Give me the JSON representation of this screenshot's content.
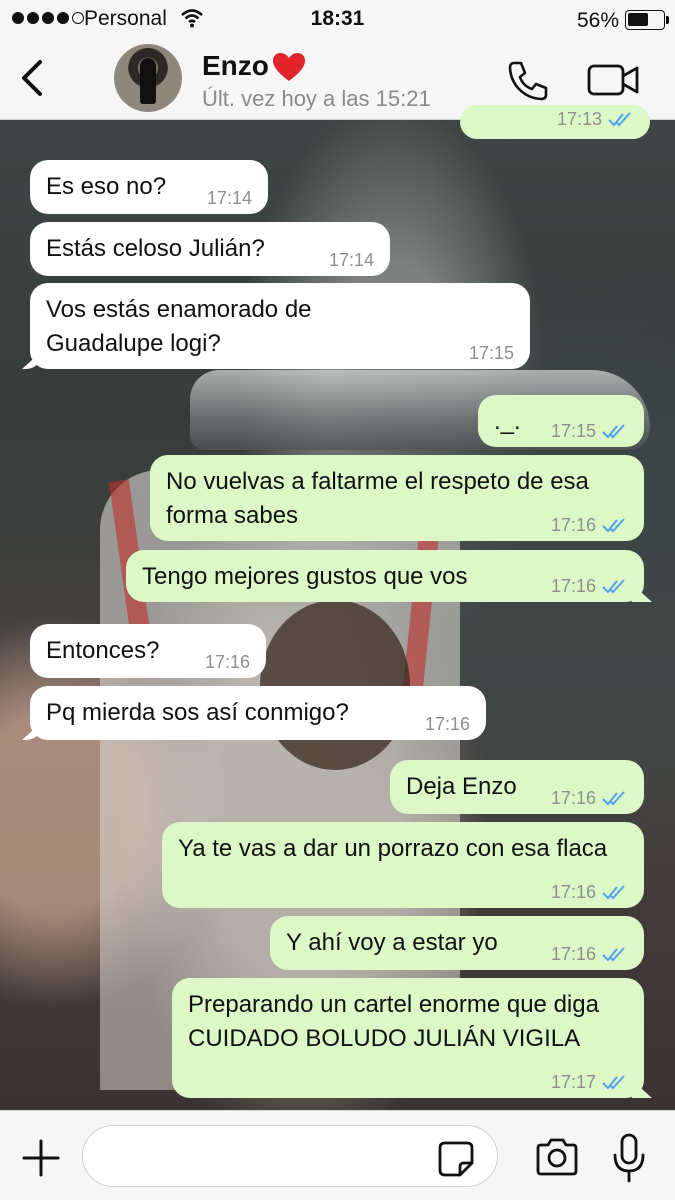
{
  "status_bar": {
    "carrier": "Personal",
    "time": "18:31",
    "battery": "56%",
    "battery_level": 0.56
  },
  "header": {
    "contact_name": "Enzo",
    "last_seen": "Últ. vez hoy a las 15:21"
  },
  "icons": {
    "back": "chevron-left-icon",
    "heart": "red-heart-icon",
    "call": "phone-icon",
    "video": "video-camera-icon",
    "plus": "plus-icon",
    "sticker": "sticker-icon",
    "camera": "camera-icon",
    "mic": "microphone-icon"
  },
  "colors": {
    "incoming_bubble": "#ffffff",
    "outgoing_bubble": "#dcf8c6",
    "read_ticks": "#4fa3f0",
    "heart": "#e0242a"
  },
  "messages": [
    {
      "direction": "out",
      "text": "",
      "time": "17:13",
      "read": true
    },
    {
      "direction": "in",
      "text": "Es eso no?",
      "time": "17:14"
    },
    {
      "direction": "in",
      "text": "Estás celoso Julián?",
      "time": "17:14"
    },
    {
      "direction": "in",
      "text": "Vos estás enamorado de Guadalupe logi?",
      "time": "17:15"
    },
    {
      "direction": "out",
      "text": "._.",
      "time": "17:15",
      "read": true
    },
    {
      "direction": "out",
      "text": "No vuelvas a faltarme el respeto de esa forma sabes",
      "time": "17:16",
      "read": true
    },
    {
      "direction": "out",
      "text": "Tengo mejores gustos que vos",
      "time": "17:16",
      "read": true
    },
    {
      "direction": "in",
      "text": "Entonces?",
      "time": "17:16"
    },
    {
      "direction": "in",
      "text": "Pq mierda sos así conmigo?",
      "time": "17:16"
    },
    {
      "direction": "out",
      "text": "Deja Enzo",
      "time": "17:16",
      "read": true
    },
    {
      "direction": "out",
      "text": "Ya te vas a dar un porrazo con esa flaca",
      "time": "17:16",
      "read": true
    },
    {
      "direction": "out",
      "text": "Y ahí voy a estar yo",
      "time": "17:16",
      "read": true
    },
    {
      "direction": "out",
      "text": "Preparando un cartel enorme que diga CUIDADO BOLUDO JULIÁN VIGILA",
      "time": "17:17",
      "read": true
    }
  ],
  "input": {
    "value": "",
    "placeholder": ""
  }
}
